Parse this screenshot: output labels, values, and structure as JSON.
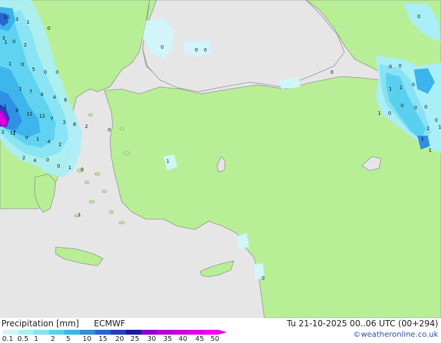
{
  "footer": {
    "title": "Precipitation [mm]",
    "model": "ECMWF",
    "runtime": "Tu 21-10-2025 00..06 UTC (00+294)",
    "credit": "©weatheronline.co.uk"
  },
  "legend": {
    "ticks": [
      "0.1",
      "0.5",
      "1",
      "2",
      "5",
      "10",
      "15",
      "20",
      "25",
      "30",
      "35",
      "40",
      "45",
      "50"
    ],
    "colors": [
      "#d2f5fa",
      "#aaeef8",
      "#86e2f4",
      "#5ad0f0",
      "#3cb3ea",
      "#2e8fe0",
      "#2966d0",
      "#2040b8",
      "#1a1a9a",
      "#8a00c8",
      "#b400d2",
      "#cc00d8",
      "#e000e0",
      "#f000f0"
    ]
  },
  "map_colors": {
    "land": "#b8ef96",
    "sea": "#e6e6e6",
    "coast": "#8e8e8e"
  },
  "precip_labels": {
    "west": [
      "10",
      "3",
      "1",
      "3",
      "0",
      "0",
      "1",
      "2",
      "1",
      "0",
      "5",
      "0",
      "0",
      "1",
      "7",
      "4",
      "4",
      "6",
      "1",
      "9",
      "11",
      "12",
      "7",
      "3",
      "8",
      "2",
      "2",
      "0",
      "1",
      "4",
      "2",
      "1",
      "17",
      "2",
      "4",
      "0",
      "1",
      "0",
      "0",
      "1",
      "0"
    ],
    "black_sea": [
      "0",
      "0",
      "0",
      "0"
    ],
    "anatolia": [
      "1",
      "0"
    ],
    "east": [
      "0",
      "0",
      "0",
      "1",
      "1",
      "0",
      "1",
      "0",
      "0",
      "0",
      "0",
      "0",
      "2",
      "1",
      "1",
      "1"
    ]
  }
}
